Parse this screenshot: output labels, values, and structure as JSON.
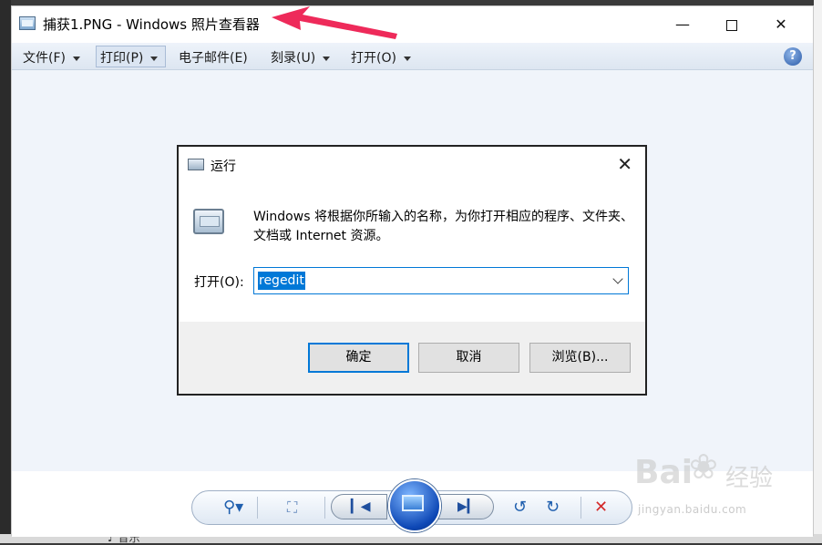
{
  "viewer": {
    "title": "捕获1.PNG - Windows 照片查看器",
    "window_controls": {
      "minimize": "—",
      "close": "✕"
    },
    "menu": [
      {
        "label": "文件(F)",
        "has_caret": true
      },
      {
        "label": "打印(P)",
        "has_caret": true
      },
      {
        "label": "电子邮件(E)",
        "has_caret": false
      },
      {
        "label": "刻录(U)",
        "has_caret": true
      },
      {
        "label": "打开(O)",
        "has_caret": true
      }
    ],
    "help": "?"
  },
  "run_dialog": {
    "title": "运行",
    "close": "✕",
    "description": "Windows 将根据你所输入的名称，为你打开相应的程序、文件夹、文档或 Internet 资源。",
    "open_label": "打开(O):",
    "input_value": "regedit",
    "buttons": {
      "ok": "确定",
      "cancel": "取消",
      "browse": "浏览(B)..."
    }
  },
  "toolbar": {
    "zoom": "⚲▾",
    "fit": "⛶",
    "prev": "▎◀",
    "next": "▶▎",
    "rotate_ccw": "↺",
    "rotate_cw": "↻",
    "delete": "✕"
  },
  "watermark": {
    "brand": "Bai",
    "paw": "❀",
    "cn": "经验",
    "url": "jingyan.baidu.com"
  },
  "background": {
    "music_label": "♪ 音乐"
  },
  "colors": {
    "accent": "#0078d7",
    "delete": "#d42a2a",
    "arrow": "#ee2a5a"
  }
}
